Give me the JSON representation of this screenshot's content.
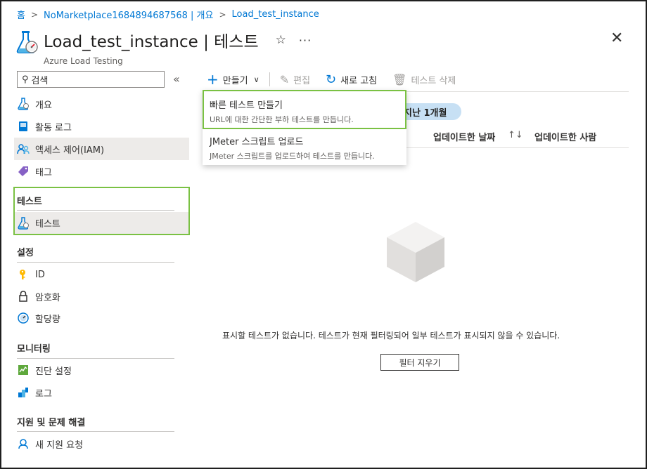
{
  "breadcrumb": [
    "홈",
    "NoMarketplace1684894687568 | 개요",
    "Load_test_instance"
  ],
  "header": {
    "title": "Load_test_instance | 테스트",
    "subtitle": "Azure Load Testing",
    "star_icon": "star-outline-icon",
    "more_icon": "ellipsis-icon",
    "close_icon": "close-icon"
  },
  "sidebar": {
    "search_placeholder": "검색",
    "collapse_icon": "double-chevron-left-icon",
    "items": [
      {
        "label": "개요",
        "icon": "flask-icon"
      },
      {
        "label": "활동 로그",
        "icon": "log-icon"
      },
      {
        "label": "액세스 제어(IAM)",
        "icon": "people-icon"
      },
      {
        "label": "태그",
        "icon": "tag-icon"
      }
    ],
    "groups": [
      {
        "title": "테스트",
        "items": [
          {
            "label": "테스트",
            "icon": "flask-icon",
            "selected": true
          }
        ]
      },
      {
        "title": "설정",
        "items": [
          {
            "label": "ID",
            "icon": "key-icon"
          },
          {
            "label": "암호화",
            "icon": "lock-icon"
          },
          {
            "label": "할당량",
            "icon": "gauge-icon"
          }
        ]
      },
      {
        "title": "모니터링",
        "items": [
          {
            "label": "진단 설정",
            "icon": "diagnostics-icon"
          },
          {
            "label": "로그",
            "icon": "logs-icon"
          }
        ]
      },
      {
        "title": "지원 및 문제 해결",
        "items": [
          {
            "label": "새 지원 요청",
            "icon": "support-icon"
          }
        ]
      }
    ]
  },
  "toolbar": {
    "create": "만들기",
    "edit": "편집",
    "refresh": "새로 고침",
    "delete": "테스트 삭제"
  },
  "filter_pill": "지난 1개월",
  "columns": [
    "업데이트한 날짜",
    "업데이트한 사람"
  ],
  "dropdown": [
    {
      "title": "빠른 테스트 만들기",
      "description": "URL에 대한 간단한 부하 테스트를 만듭니다."
    },
    {
      "title": "JMeter 스크립트 업로드",
      "description": "JMeter 스크립트를 업로드하여 테스트를 만듭니다."
    }
  ],
  "empty_state": {
    "message": "표시할 테스트가 없습니다. 테스트가 현재 필터링되어 일부 테스트가 표시되지 않을 수 있습니다.",
    "button": "필터 지우기",
    "icon": "empty-cube-icon"
  },
  "colors": {
    "accent": "#0078d4",
    "highlight_border": "#7ac143",
    "pill": "#c7e0f4"
  }
}
